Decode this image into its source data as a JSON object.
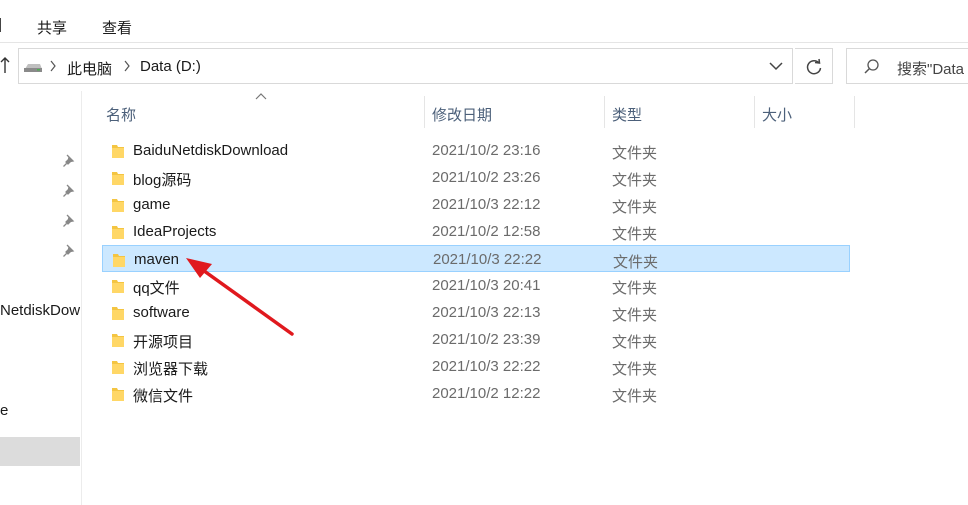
{
  "ribbon": {
    "tabs": [
      {
        "label": "共享"
      },
      {
        "label": "查看"
      }
    ]
  },
  "address": {
    "crumbs": [
      "此电脑",
      "Data (D:)"
    ]
  },
  "search": {
    "placeholder": "搜索\"Data"
  },
  "nav_pane": {
    "items": [
      "NetdiskDow",
      "e"
    ]
  },
  "columns": {
    "name": "名称",
    "date": "修改日期",
    "type": "类型",
    "size": "大小"
  },
  "files": [
    {
      "name": "BaiduNetdiskDownload",
      "date": "2021/10/2 23:16",
      "type": "文件夹"
    },
    {
      "name": "blog源码",
      "date": "2021/10/2 23:26",
      "type": "文件夹"
    },
    {
      "name": "game",
      "date": "2021/10/3 22:12",
      "type": "文件夹"
    },
    {
      "name": "IdeaProjects",
      "date": "2021/10/2 12:58",
      "type": "文件夹"
    },
    {
      "name": "maven",
      "date": "2021/10/3 22:22",
      "type": "文件夹",
      "selected": true
    },
    {
      "name": "qq文件",
      "date": "2021/10/3 20:41",
      "type": "文件夹"
    },
    {
      "name": "software",
      "date": "2021/10/3 22:13",
      "type": "文件夹"
    },
    {
      "name": "开源项目",
      "date": "2021/10/2 23:39",
      "type": "文件夹"
    },
    {
      "name": "浏览器下载",
      "date": "2021/10/3 22:22",
      "type": "文件夹"
    },
    {
      "name": "微信文件",
      "date": "2021/10/2 12:22",
      "type": "文件夹"
    }
  ],
  "colors": {
    "selection_bg": "#cce8ff",
    "selection_border": "#99d1ff",
    "folder": "#f4c542",
    "annotation_arrow": "#e0191e"
  },
  "icons": [
    "up-arrow-icon",
    "drive-icon",
    "chevron-right-icon",
    "chevron-down-icon",
    "refresh-icon",
    "search-icon",
    "pin-icon",
    "folder-icon"
  ]
}
